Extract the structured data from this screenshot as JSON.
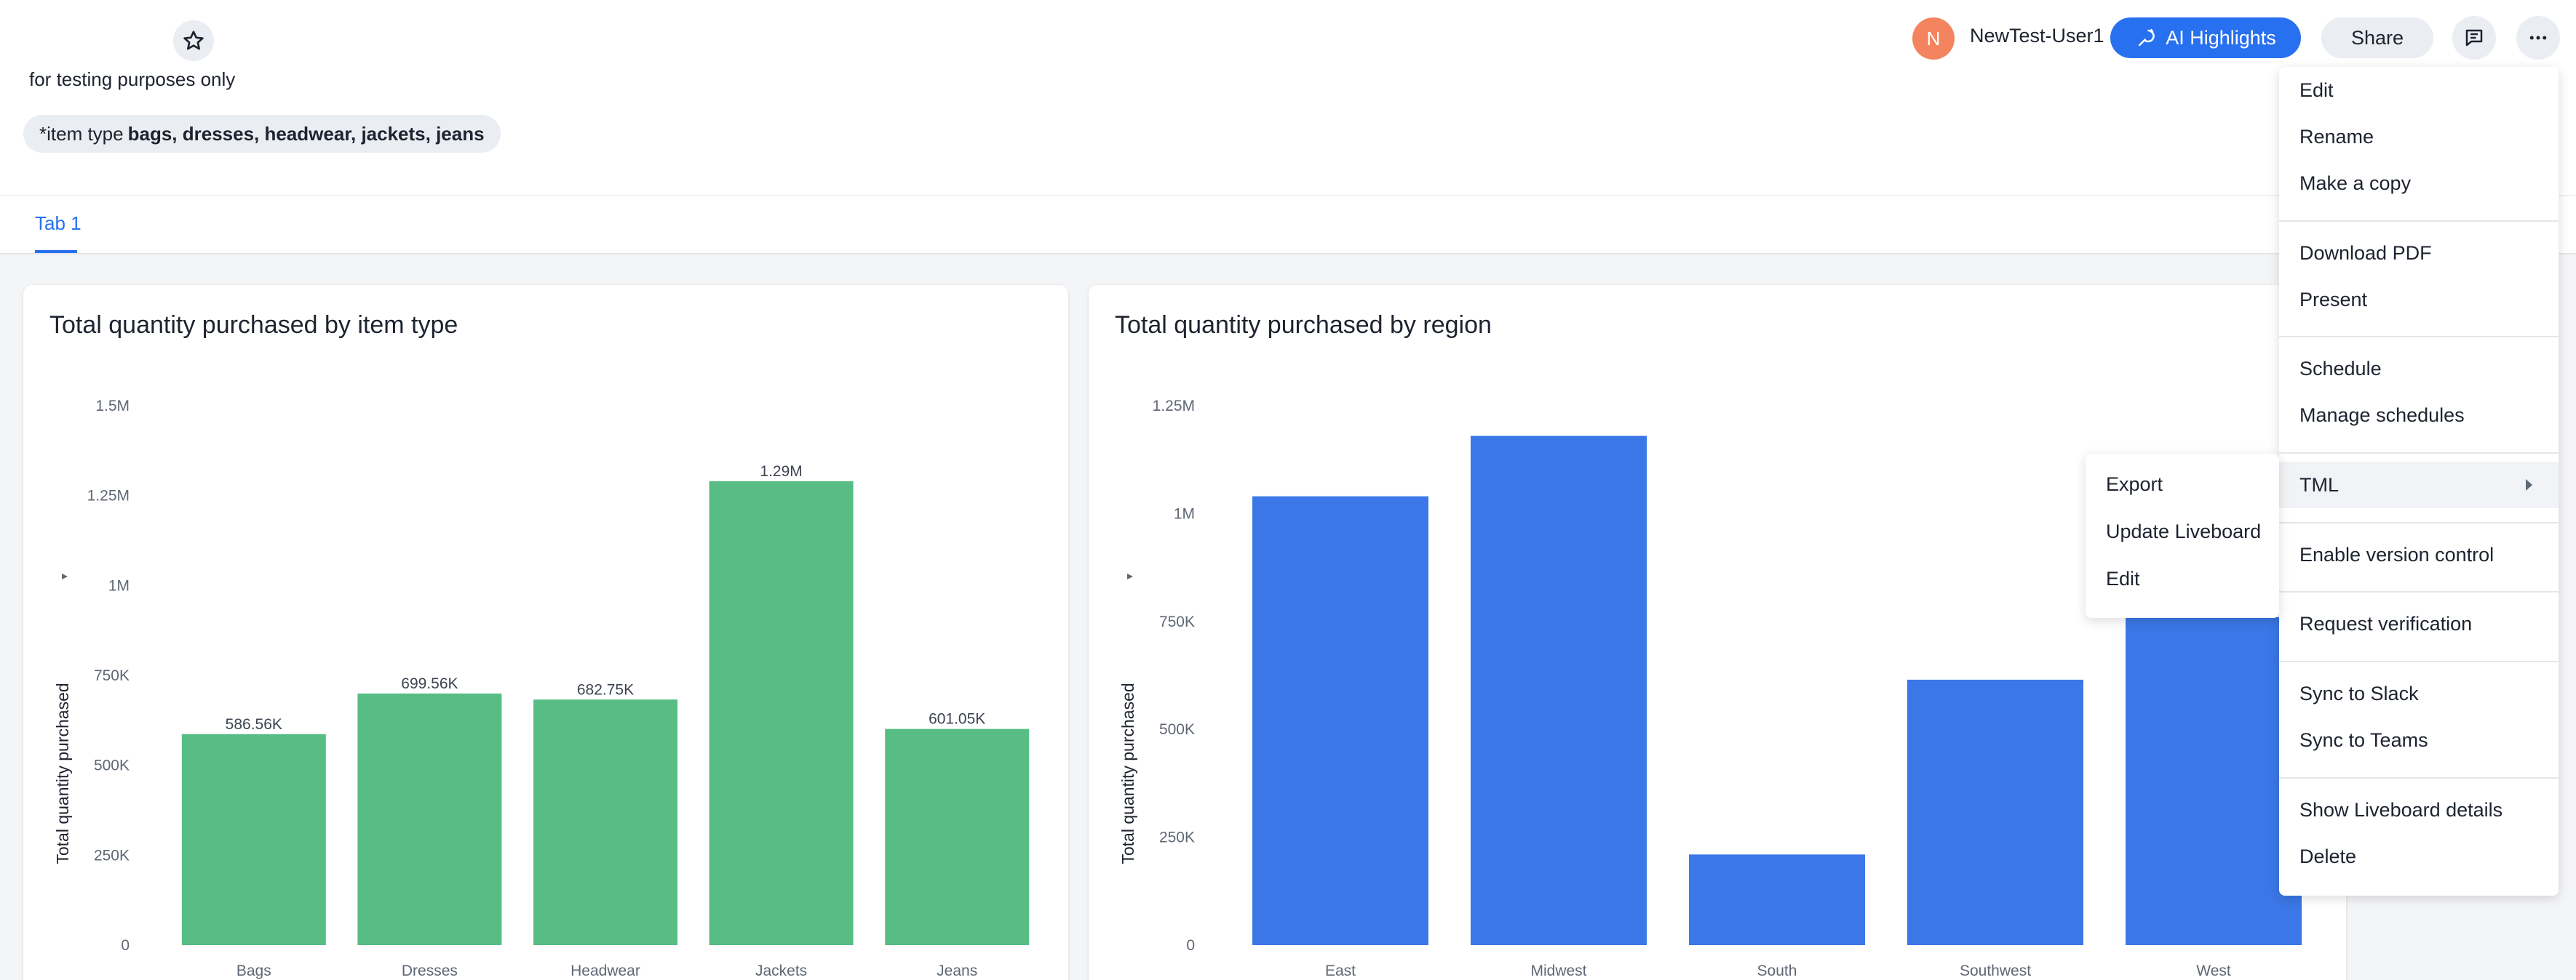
{
  "header": {
    "subtitle": "for testing purposes only",
    "filter": {
      "label": "*item type",
      "value": "bags, dresses, headwear, jackets, jeans"
    },
    "user": {
      "initial": "N",
      "name": "NewTest-User1"
    },
    "ai_highlights_label": "AI Highlights",
    "share_label": "Share"
  },
  "tabs": [
    {
      "label": "Tab 1",
      "active": true
    }
  ],
  "colors": {
    "accent": "#2770ef",
    "green_bar": "#57bd84",
    "blue_bar": "#3b77e6",
    "avatar": "#f4845f"
  },
  "charts": [
    {
      "title": "Total quantity purchased by item type",
      "ylabel": "Total quantity purchased",
      "ticks": [
        "0",
        "250K",
        "500K",
        "750K",
        "1M",
        "1.25M",
        "1.5M"
      ]
    },
    {
      "title": "Total quantity purchased by region",
      "ylabel": "Total quantity purchased",
      "ticks": [
        "0",
        "250K",
        "500K",
        "750K",
        "1M",
        "1.25M"
      ]
    }
  ],
  "chart_data": [
    {
      "type": "bar",
      "title": "Total quantity purchased by item type",
      "xlabel": "",
      "ylabel": "Total quantity purchased",
      "categories": [
        "Bags",
        "Dresses",
        "Headwear",
        "Jackets",
        "Jeans"
      ],
      "values": [
        586560,
        699560,
        682750,
        1290000,
        601050
      ],
      "data_labels": [
        "586.56K",
        "699.56K",
        "682.75K",
        "1.29M",
        "601.05K"
      ],
      "ylim": [
        0,
        1500000
      ],
      "grid": false,
      "color": "#57bd84"
    },
    {
      "type": "bar",
      "title": "Total quantity purchased by region",
      "xlabel": "",
      "ylabel": "Total quantity purchased",
      "categories": [
        "East",
        "Midwest",
        "South",
        "Southwest",
        "West"
      ],
      "values": [
        1040000,
        1180000,
        210000,
        615000,
        760000
      ],
      "ylim": [
        0,
        1250000
      ],
      "grid": false,
      "color": "#3b77e6"
    }
  ],
  "menu": {
    "items": [
      "Edit",
      "Rename",
      "Make a copy",
      "Download PDF",
      "Present",
      "Schedule",
      "Manage schedules",
      "TML",
      "Enable version control",
      "Request verification",
      "Sync to Slack",
      "Sync to Teams",
      "Show Liveboard details",
      "Delete"
    ],
    "submenu": [
      "Export",
      "Update Liveboard",
      "Edit"
    ]
  },
  "icons": [
    "star-icon",
    "ai-highlights-icon",
    "comment-icon",
    "more-icon"
  ]
}
